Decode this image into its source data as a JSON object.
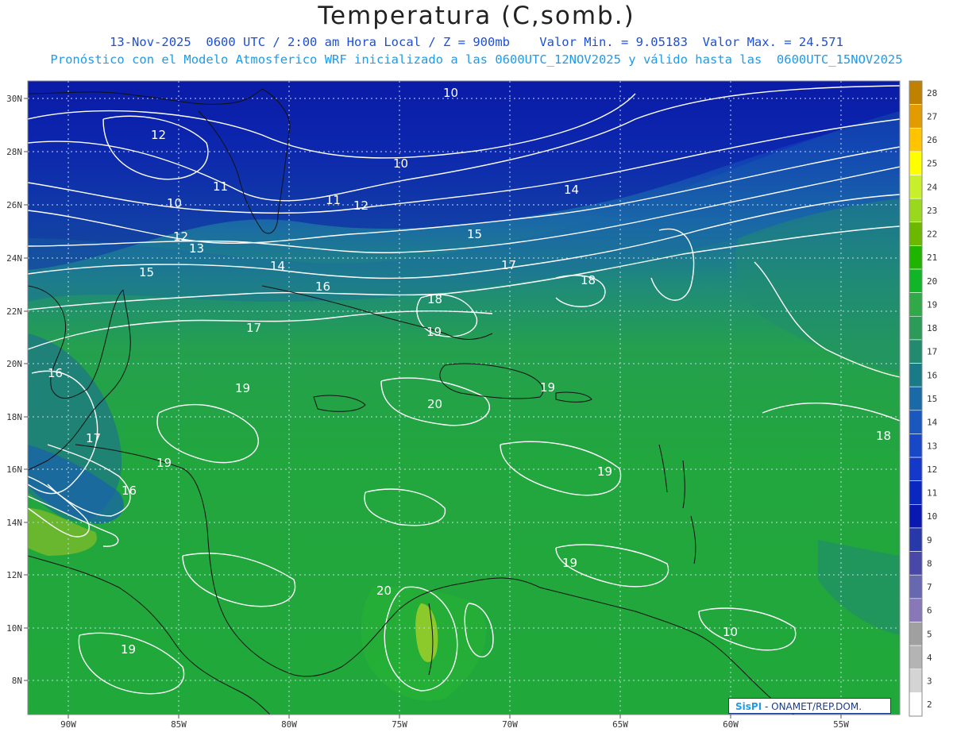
{
  "header": {
    "title": "Temperatura (C,somb.)",
    "line1": "13-Nov-2025  0600 UTC / 2:00 am Hora Local / Z = 900mb    Valor Min. = 9.05183  Valor Max. = 24.571",
    "line2": "Pronóstico con el Modelo Atmosferico WRF inicializado a las 0600UTC_12NOV2025 y válido hasta las  0600UTC_15NOV2025"
  },
  "axes": {
    "lat_labels": [
      "30N",
      "28N",
      "26N",
      "24N",
      "22N",
      "20N",
      "18N",
      "16N",
      "14N",
      "12N",
      "10N",
      "8N"
    ],
    "lon_labels": [
      "90W",
      "85W",
      "80W",
      "75W",
      "70W",
      "65W",
      "60W",
      "55W"
    ]
  },
  "contour_labels": [
    "12",
    "10",
    "11",
    "10",
    "12",
    "13",
    "15",
    "14",
    "16",
    "17",
    "16",
    "17",
    "16",
    "19",
    "19",
    "20",
    "19",
    "19",
    "20",
    "19",
    "19",
    "18",
    "18",
    "18",
    "19",
    "17",
    "15",
    "14",
    "12",
    "11",
    "10",
    "10",
    "18"
  ],
  "colorbar": {
    "levels": [
      "28",
      "27",
      "26",
      "25",
      "24",
      "23",
      "22",
      "21",
      "20",
      "19",
      "18",
      "17",
      "16",
      "15",
      "14",
      "13",
      "12",
      "11",
      "10",
      "9",
      "8",
      "7",
      "6",
      "5",
      "4",
      "3",
      "2"
    ],
    "colors": [
      "#c08000",
      "#e29b00",
      "#ffc400",
      "#ffff00",
      "#c8f02a",
      "#9ad81e",
      "#6cb800",
      "#1eb400",
      "#12b428",
      "#30aa48",
      "#2c9a58",
      "#228a6e",
      "#1b7a88",
      "#1a6aa8",
      "#1a58c0",
      "#1848c8",
      "#1438c8",
      "#0a28c0",
      "#0818b0",
      "#2838a8",
      "#4848a8",
      "#6868b0",
      "#8878b8",
      "#a0a0a0",
      "#b4b4b4",
      "#d4d4d4",
      "#ffffff"
    ]
  },
  "logo": {
    "brand": "SisPI",
    "text": " - ONAMET/REP.DOM."
  }
}
